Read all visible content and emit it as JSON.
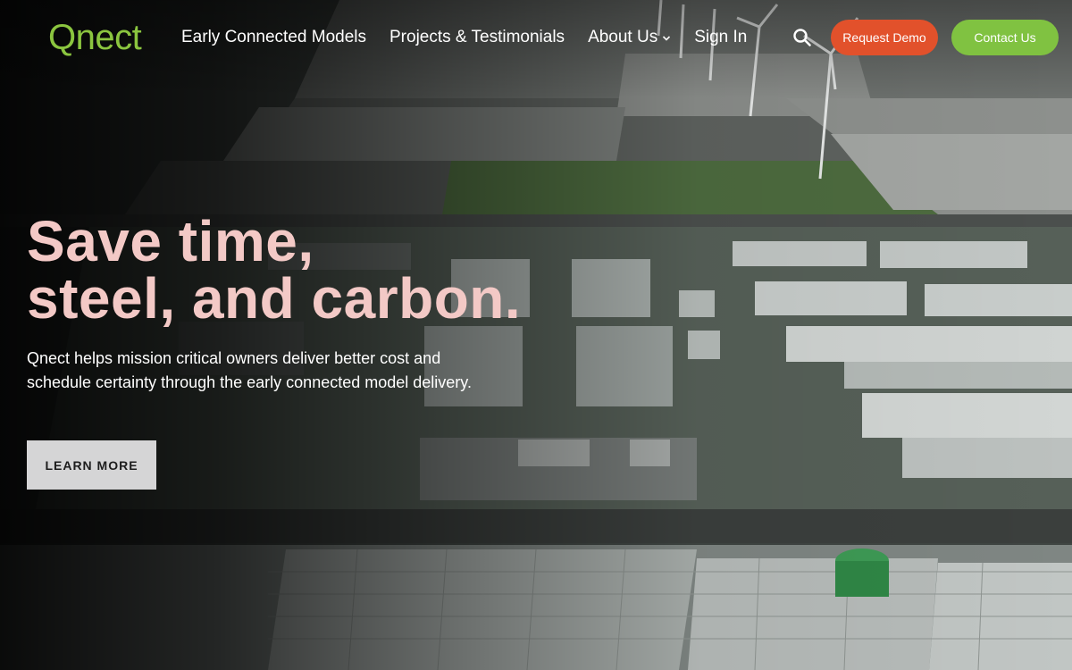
{
  "brand": {
    "logo_text": "Qnect",
    "accent": "#8bc53f"
  },
  "nav": {
    "links": [
      {
        "label": "Early Connected Models"
      },
      {
        "label": "Projects & Testimonials"
      },
      {
        "label": "About Us",
        "icon": "chevron-down-icon"
      },
      {
        "label": "Sign In"
      }
    ],
    "search_icon": "search-icon",
    "request_demo": {
      "label": "Request Demo",
      "color": "#e2512b"
    },
    "contact_us": {
      "label": "Contact Us",
      "color": "#80c241"
    }
  },
  "hero": {
    "headline_line1": "Save time,",
    "headline_line2": "steel, and carbon.",
    "headline_color": "#f3c9c6",
    "subtext_line1": "Qnect helps mission critical owners deliver better cost and",
    "subtext_line2": "schedule certainty through the early connected model delivery.",
    "cta_label": "LEARN MORE",
    "background": "aerial view of data center campus with wind turbines and greenhouses"
  }
}
